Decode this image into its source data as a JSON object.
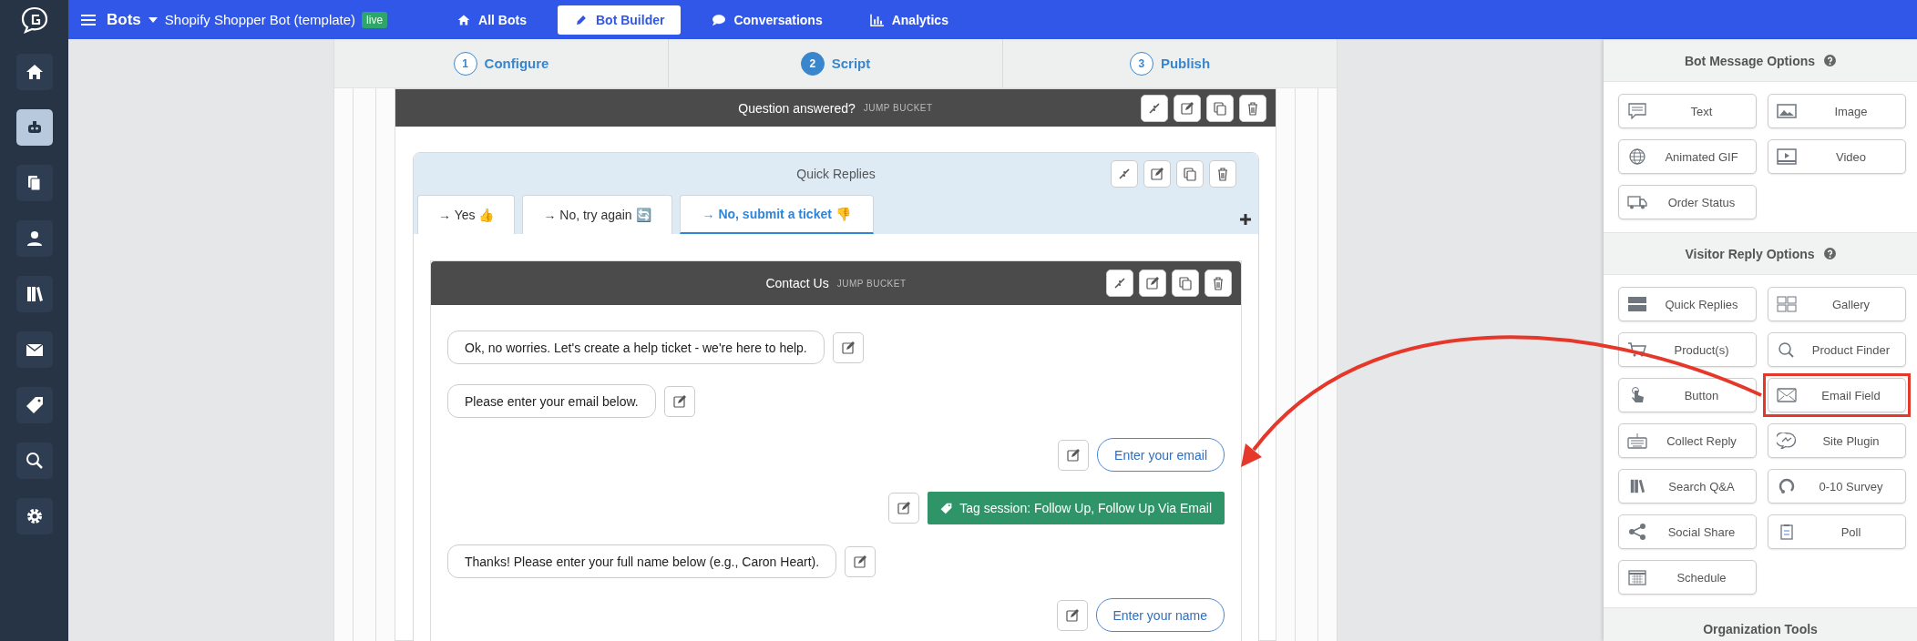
{
  "sidebar": {
    "items": [
      {
        "kind": "home",
        "selected": false
      },
      {
        "kind": "bot",
        "selected": true
      },
      {
        "kind": "pages",
        "selected": false
      },
      {
        "kind": "person",
        "selected": false
      },
      {
        "kind": "books",
        "selected": false
      },
      {
        "kind": "mail",
        "selected": false
      },
      {
        "kind": "tag",
        "selected": false
      },
      {
        "kind": "search",
        "selected": false
      },
      {
        "kind": "settings",
        "selected": false
      }
    ]
  },
  "topbar": {
    "section": "Bots",
    "bot_name": "Shopify Shopper Bot (template)",
    "status_badge": "live",
    "nav": [
      {
        "label": "All Bots",
        "kind": "home",
        "selected": false
      },
      {
        "label": "Bot Builder",
        "kind": "pencil",
        "selected": true
      },
      {
        "label": "Conversations",
        "kind": "chat",
        "selected": false
      },
      {
        "label": "Analytics",
        "kind": "chart",
        "selected": false
      }
    ]
  },
  "stepper": [
    {
      "number": "1",
      "label": "Configure",
      "selected": false
    },
    {
      "number": "2",
      "label": "Script",
      "selected": true
    },
    {
      "number": "3",
      "label": "Publish",
      "selected": false
    }
  ],
  "canvas": {
    "question_block": {
      "title": "Question answered?",
      "tag": "JUMP BUCKET"
    },
    "quick_replies": {
      "title": "Quick Replies",
      "tabs": [
        {
          "label": "→ Yes 👍",
          "selected": false
        },
        {
          "label": "→ No, try again 🔄",
          "selected": false
        },
        {
          "label": "→ No, submit a ticket 👎",
          "selected": true
        }
      ]
    },
    "contact_block": {
      "title": "Contact Us",
      "tag": "JUMP BUCKET",
      "messages": [
        {
          "kind": "bot",
          "text": "Ok, no worries. Let's create a help ticket - we're here to help."
        },
        {
          "kind": "bot",
          "text": "Please enter your email below."
        },
        {
          "kind": "input",
          "text": "Enter your email"
        },
        {
          "kind": "tag",
          "text": "Tag session: Follow Up, Follow Up Via Email"
        },
        {
          "kind": "bot",
          "text": "Thanks! Please enter your full name below (e.g., Caron Heart)."
        },
        {
          "kind": "input",
          "text": "Enter your name"
        }
      ]
    }
  },
  "right_panel": {
    "sections": [
      {
        "title": "Bot Message Options",
        "help": true,
        "options": [
          {
            "label": "Text",
            "kind": "text",
            "highlighted": false
          },
          {
            "label": "Image",
            "kind": "image",
            "highlighted": false
          },
          {
            "label": "Animated GIF",
            "kind": "gif",
            "highlighted": false
          },
          {
            "label": "Video",
            "kind": "video",
            "highlighted": false
          },
          {
            "label": "Order Status",
            "kind": "truck",
            "highlighted": false
          }
        ]
      },
      {
        "title": "Visitor Reply Options",
        "help": true,
        "options": [
          {
            "label": "Quick Replies",
            "kind": "quick",
            "highlighted": false
          },
          {
            "label": "Gallery",
            "kind": "gallery",
            "highlighted": false
          },
          {
            "label": "Product(s)",
            "kind": "cart",
            "highlighted": false
          },
          {
            "label": "Product Finder",
            "kind": "finder",
            "highlighted": false
          },
          {
            "label": "Button",
            "kind": "hand",
            "highlighted": false
          },
          {
            "label": "Email Field",
            "kind": "email",
            "highlighted": true
          },
          {
            "label": "Collect Reply",
            "kind": "keyboard",
            "highlighted": false
          },
          {
            "label": "Site Plugin",
            "kind": "plugin",
            "highlighted": false
          },
          {
            "label": "Search Q&A",
            "kind": "books",
            "highlighted": false
          },
          {
            "label": "0-10 Survey",
            "kind": "survey",
            "highlighted": false
          },
          {
            "label": "Social Share",
            "kind": "share",
            "highlighted": false
          },
          {
            "label": "Poll",
            "kind": "poll",
            "highlighted": false
          },
          {
            "label": "Schedule",
            "kind": "calendar",
            "highlighted": false
          }
        ]
      },
      {
        "title": "Organization Tools",
        "help": false
      }
    ]
  }
}
